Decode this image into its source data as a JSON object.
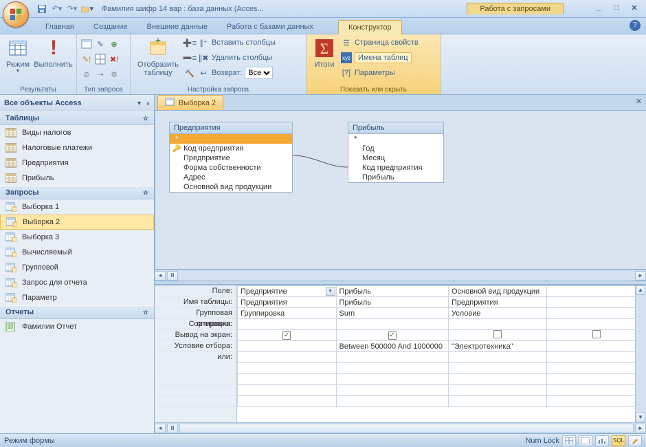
{
  "title": "Фамилия шифр 14 вар : база данных (Acces...",
  "context_tab_group": "Работа с запросами",
  "ribbon_tabs": [
    "Главная",
    "Создание",
    "Внешние данные",
    "Работа с базами данных"
  ],
  "ribbon_context_tab": "Конструктор",
  "ribbon": {
    "results_group": "Результаты",
    "view": "Режим",
    "run": "Выполнить",
    "querytype_group": "Тип запроса",
    "setup_group": "Настройка запроса",
    "show_table": "Отобразить\nтаблицу",
    "insert_cols": "Вставить столбцы",
    "delete_cols": "Удалить столбцы",
    "return_lbl": "Возврат:",
    "return_val": "Все",
    "totals": "Итоги",
    "showhide_group": "Показать или скрыть",
    "prop_sheet": "Страница свойств",
    "table_names": "Имена таблиц",
    "parameters": "Параметры"
  },
  "nav": {
    "header": "Все объекты Access",
    "groups": [
      {
        "title": "Таблицы",
        "type": "table",
        "items": [
          "Виды налогов",
          "Налоговые платежи",
          "Предприятия",
          "Прибыль"
        ]
      },
      {
        "title": "Запросы",
        "type": "query",
        "items": [
          "Выборка 1",
          "Выборка 2",
          "Выборка 3",
          "Вычисляемый",
          "Групповой",
          "Запрос для отчета",
          "Параметр"
        ],
        "selected": "Выборка 2"
      },
      {
        "title": "Отчеты",
        "type": "report",
        "items": [
          "Фамилии Отчет"
        ]
      }
    ]
  },
  "doc_tab": "Выборка 2",
  "tables": {
    "t1": {
      "title": "Предприятия",
      "fields": [
        "*",
        "Код предприятия",
        "Предприятие",
        "Форма собственности",
        "Адрес",
        "Основной вид продукции"
      ],
      "key": 1,
      "star_sel": true
    },
    "t2": {
      "title": "Прибыль",
      "fields": [
        "*",
        "Год",
        "Месяц",
        "Код предприятия",
        "Прибыль"
      ]
    }
  },
  "qbe": {
    "labels": [
      "Поле:",
      "Имя таблицы:",
      "Групповая операция:",
      "Сортировка:",
      "Вывод на экран:",
      "Условие отбора:",
      "или:"
    ],
    "cols": [
      {
        "field": "Предприятие",
        "table": "Предприятия",
        "total": "Группировка",
        "show": true,
        "criteria": "",
        "dd": true
      },
      {
        "field": "Прибыль",
        "table": "Прибыль",
        "total": "Sum",
        "show": true,
        "criteria": "Between 500000 And 1000000"
      },
      {
        "field": "Основной вид продукции",
        "table": "Предприятия",
        "total": "Условие",
        "show": false,
        "criteria": "\"Электротехника\""
      },
      {
        "field": "",
        "table": "",
        "total": "",
        "show": false,
        "criteria": ""
      }
    ]
  },
  "status": {
    "left": "Режим формы",
    "numlock": "Num Lock"
  }
}
